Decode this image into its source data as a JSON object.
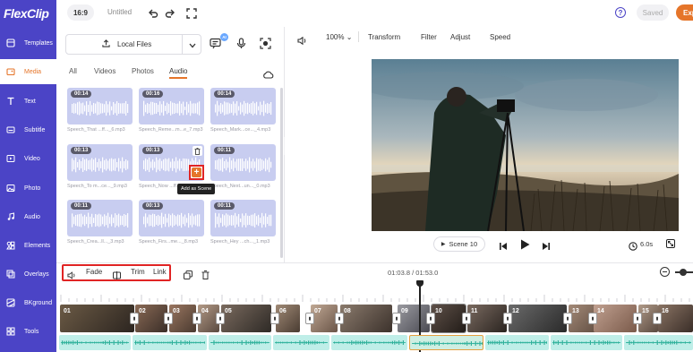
{
  "app": {
    "logo": "FlexClip",
    "aspect_ratio": "16:9",
    "title": "Untitled",
    "saved": "Saved",
    "export_label": "Exp"
  },
  "sidebar": {
    "items": [
      {
        "label": "Templates",
        "icon": "templates-icon"
      },
      {
        "label": "Media",
        "icon": "media-icon"
      },
      {
        "label": "Text",
        "icon": "text-icon"
      },
      {
        "label": "Subtitle",
        "icon": "subtitle-icon"
      },
      {
        "label": "Video",
        "icon": "video-icon"
      },
      {
        "label": "Photo",
        "icon": "photo-icon"
      },
      {
        "label": "Audio",
        "icon": "audio-icon"
      },
      {
        "label": "Elements",
        "icon": "elements-icon"
      },
      {
        "label": "Overlays",
        "icon": "overlays-icon"
      },
      {
        "label": "BKground",
        "icon": "background-icon"
      },
      {
        "label": "Tools",
        "icon": "tools-icon"
      }
    ],
    "active": "Media"
  },
  "panel": {
    "local_files": "Local Files",
    "ai_badge": "AI",
    "tabs": [
      "All",
      "Videos",
      "Photos",
      "Audio"
    ],
    "active_tab": "Audio",
    "cards": [
      {
        "duration": "00:14",
        "caption": "Speech_That ...ff..._6.mp3"
      },
      {
        "duration": "00:16",
        "caption": "Speech_Reme...m...e_7.mp3"
      },
      {
        "duration": "00:14",
        "caption": "Speech_Mark...ce..._4.mp3"
      },
      {
        "duration": "00:13",
        "caption": "Speech_To m...ce..._9.mp3"
      },
      {
        "duration": "00:13",
        "caption": "Speech_Now ...ff..._2.mp3"
      },
      {
        "duration": "00:11",
        "caption": "Speech_Next...un..._0.mp3"
      },
      {
        "duration": "00:11",
        "caption": "Speech_Crea...ll..._3.mp3"
      },
      {
        "duration": "00:13",
        "caption": "Speech_Firs...me..._8.mp3"
      },
      {
        "duration": "00:11",
        "caption": "Speech_Hey ...ch..._1.mp3"
      }
    ],
    "tooltip": "Add as Scene"
  },
  "preview": {
    "volume_pct": "100%",
    "tools": [
      "Transform",
      "Filter",
      "Adjust",
      "Speed"
    ],
    "scene_label": "Scene 10",
    "duration": "6.0s"
  },
  "timeline": {
    "tools": [
      "Fade",
      "Trim",
      "Link"
    ],
    "timecode": "01:03.8 / 01:53.0",
    "clips": [
      "01",
      "02",
      "03",
      "04",
      "05",
      "06",
      "07",
      "08",
      "09",
      "10",
      "11",
      "12",
      "13",
      "14",
      "15",
      "16"
    ]
  },
  "colors": {
    "sidebar": "#4b44c6",
    "accent": "#e5752a",
    "highlight": "#e02424",
    "audio_track": "#bfeee8"
  }
}
